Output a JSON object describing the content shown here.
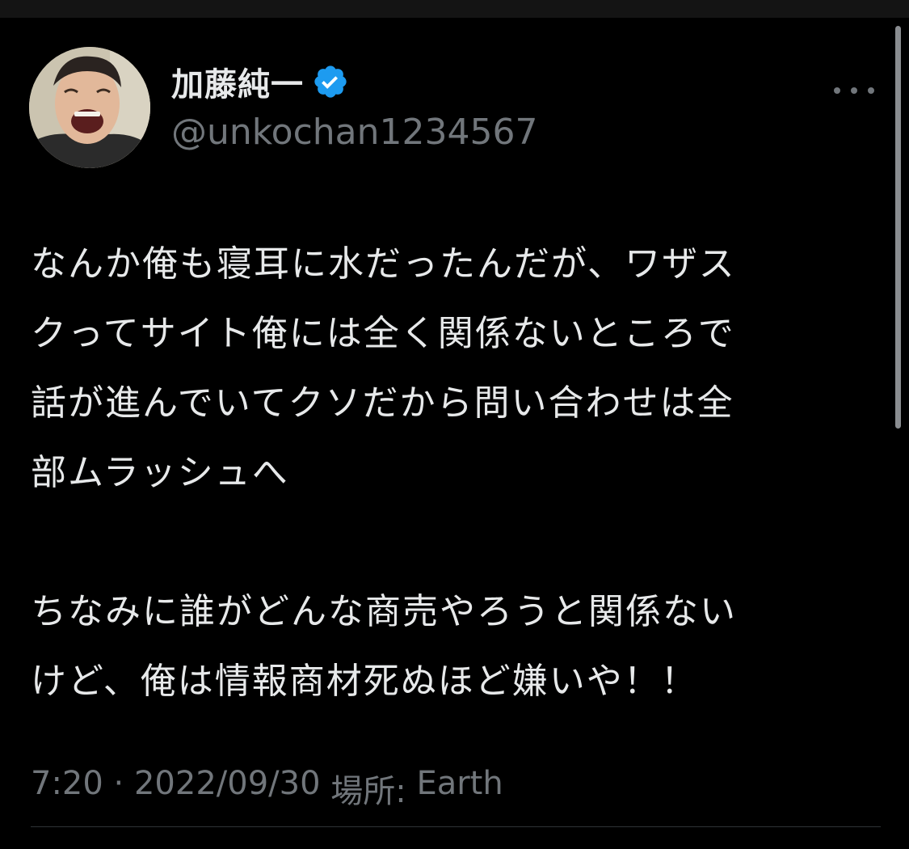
{
  "tweet": {
    "author": {
      "display_name": "加藤純一",
      "handle": "@unkochan1234567",
      "verified": true
    },
    "body": "なんか俺も寝耳に水だったんだが、ワザス\nクってサイト俺には全く関係ないところで\n話が進んでいてクソだから問い合わせは全\n部ムラッシュへ\n\nちなみに誰がどんな商売やろうと関係ない\nけど、俺は情報商材死ぬほど嫌いや！！",
    "meta": {
      "time": "7:20",
      "separator": " · ",
      "date": "2022/09/30",
      "location_label": " 場所: ",
      "location": "Earth"
    }
  },
  "icons": {
    "verified": "verified-badge-icon",
    "more": "more-options-icon"
  },
  "colors": {
    "background": "#000000",
    "text_primary": "#e7e9ea",
    "text_secondary": "#71767b",
    "verified_blue": "#1d9bf0"
  }
}
